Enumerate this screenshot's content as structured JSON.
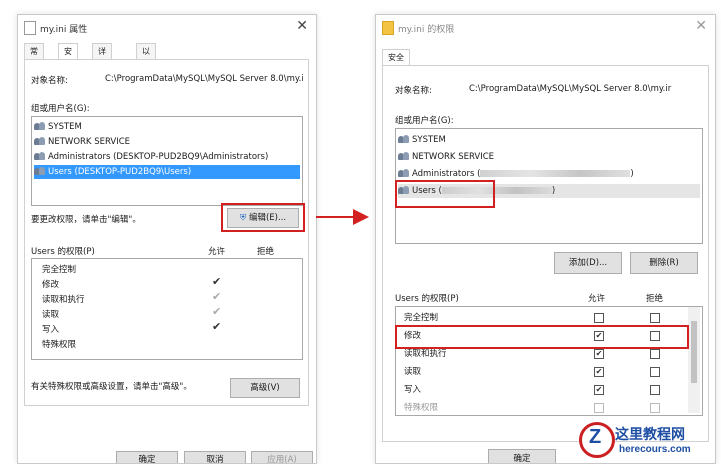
{
  "left": {
    "title": "my.ini 属性",
    "tabs": [
      "常规",
      "安全",
      "详细信息",
      "以前的版本"
    ],
    "object_label": "对象名称:",
    "object_path": "C:\\ProgramData\\MySQL\\MySQL Server 8.0\\my.i",
    "group_label": "组或用户名(G):",
    "users": [
      "SYSTEM",
      "NETWORK SERVICE",
      "Administrators (DESKTOP-PUD2BQ9\\Administrators)",
      "Users (DESKTOP-PUD2BQ9\\Users)"
    ],
    "edit_hint": "要更改权限，请单击\"编辑\"。",
    "edit_button": "编辑(E)...",
    "perm_header": "Users 的权限(P)",
    "allow": "允许",
    "deny": "拒绝",
    "perms": [
      "完全控制",
      "修改",
      "读取和执行",
      "读取",
      "写入",
      "特殊权限"
    ],
    "allow_checks": [
      false,
      true,
      true,
      true,
      true,
      false
    ],
    "advanced_hint": "有关特殊权限或高级设置，请单击\"高级\"。",
    "advanced_button": "高级(V)",
    "ok": "确定",
    "cancel": "取消",
    "apply": "应用(A)"
  },
  "right": {
    "title": "my.ini 的权限",
    "tab": "安全",
    "object_label": "对象名称:",
    "object_path": "C:\\ProgramData\\MySQL\\MySQL Server 8.0\\my.ir",
    "group_label": "组或用户名(G):",
    "users": [
      "SYSTEM",
      "NETWORK SERVICE",
      "Administrators (",
      "Users ("
    ],
    "users_tail": [
      ")",
      ")"
    ],
    "add_button": "添加(D)...",
    "remove_button": "删除(R)",
    "perm_header": "Users 的权限(P)",
    "allow": "允许",
    "deny": "拒绝",
    "perms": [
      "完全控制",
      "修改",
      "读取和执行",
      "读取",
      "写入",
      "特殊权限"
    ],
    "allow_checks": [
      false,
      true,
      true,
      true,
      true,
      false
    ],
    "deny_checks": [
      false,
      false,
      false,
      false,
      false,
      false
    ],
    "ok": "确定"
  },
  "watermark": {
    "name": "这里教程网",
    "url": "herecours.com"
  },
  "colors": {
    "accent": "#0078d7",
    "highlight": "#3399ff",
    "annotation": "#d32121"
  },
  "icons": {
    "check": "✔",
    "close": "✕"
  }
}
